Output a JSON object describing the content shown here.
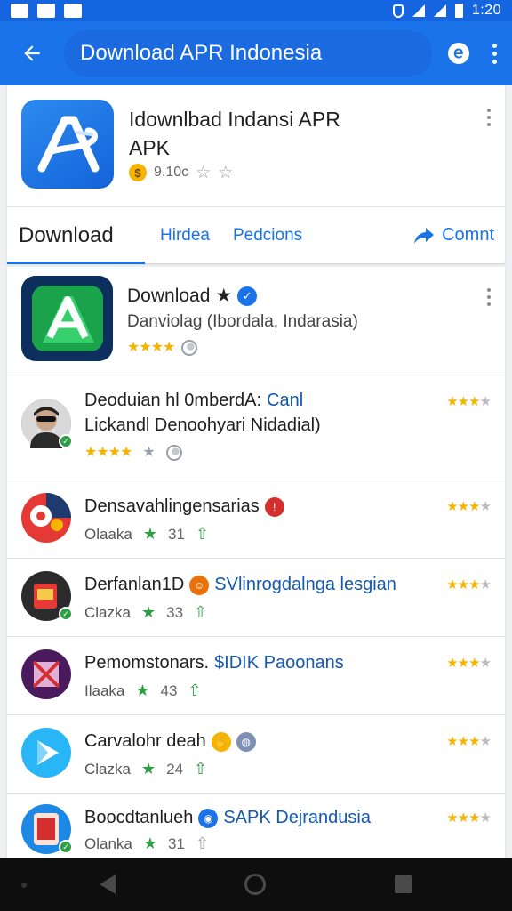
{
  "status_bar": {
    "time": "1:20"
  },
  "app_bar": {
    "title": "Download APR Indonesia"
  },
  "header": {
    "title": "Idownlbad Indansi APR APK",
    "meta_text": "9.10c",
    "tabs": [
      {
        "label": "Download"
      },
      {
        "label": "Hirdea"
      },
      {
        "label": "Pedcions"
      },
      {
        "label": "Comnt"
      }
    ]
  },
  "featured": {
    "name": "Download",
    "star_glyph": "★",
    "subtitle": "Danviolag (Ibordala, Indarasia)",
    "rating": 4
  },
  "results": [
    {
      "name": "Deoduian hl 0mberdA:",
      "link": "Canl",
      "line2": "Lickandl Denoohyari Nidadial)",
      "rating": 2.5,
      "stars_rating": 4.5
    },
    {
      "name": "Densavahlingensarias",
      "meta_label": "Olaaka",
      "count": "31",
      "rating": 3
    },
    {
      "name": "Derfanlan1D",
      "link": "SVlinrogdalnga lesgian",
      "meta_label": "Clazka",
      "count": "33",
      "rating": 2.5
    },
    {
      "name": "Pemomstonars.",
      "link": "$IDIK Paoonans",
      "meta_label": "Ilaaka",
      "count": "43",
      "rating": 3
    },
    {
      "name": "Carvalohr deah",
      "meta_label": "Clazka",
      "count": "24",
      "rating": 2.5
    },
    {
      "name": "Boocdtanlueh",
      "link": "SAPK Dejrandusia",
      "meta_label": "Olanka",
      "count": "31",
      "rating": 2.5
    }
  ],
  "colors": {
    "primary": "#1a73e8",
    "status_bar": "#1565e0",
    "star": "#f4b400",
    "leaf": "#2e9e44"
  }
}
